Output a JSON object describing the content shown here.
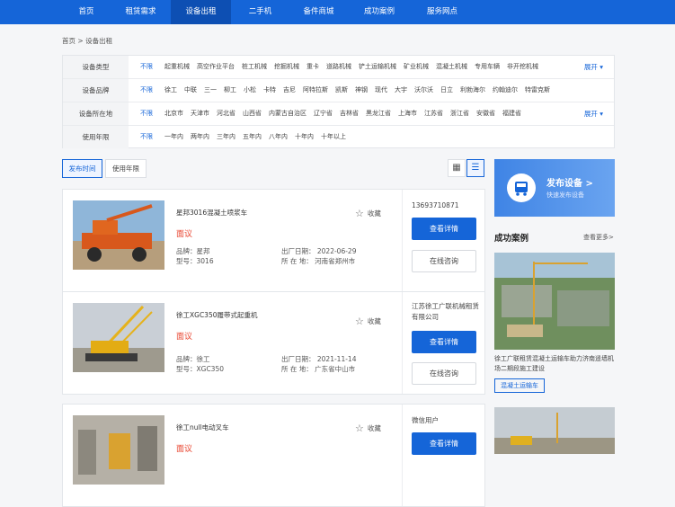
{
  "nav": {
    "items": [
      "首页",
      "租赁需求",
      "设备出租",
      "二手机",
      "备件商城",
      "成功案例",
      "服务网点"
    ],
    "active_index": 2
  },
  "breadcrumb": {
    "home": "首页",
    "separator": ">",
    "current": "设备出租"
  },
  "filters": [
    {
      "label": "设备类型",
      "selected": "不限",
      "options": [
        "起重机械",
        "高空作业平台",
        "桩工机械",
        "挖掘机械",
        "重卡",
        "道路机械",
        "铲土运输机械",
        "矿业机械",
        "混凝土机械",
        "专用车辆",
        "非开挖机械"
      ],
      "expand": "展开"
    },
    {
      "label": "设备品牌",
      "selected": "不限",
      "options": [
        "徐工",
        "中联",
        "三一",
        "柳工",
        "小松",
        "卡特",
        "吉尼",
        "阿特拉斯",
        "凯斯",
        "神钢",
        "现代",
        "大宇",
        "沃尔沃",
        "日立",
        "利勃海尔",
        "约翰迪尔",
        "特雷克斯"
      ],
      "expand": ""
    },
    {
      "label": "设备所在地",
      "selected": "不限",
      "options": [
        "北京市",
        "天津市",
        "河北省",
        "山西省",
        "内蒙古自治区",
        "辽宁省",
        "吉林省",
        "黑龙江省",
        "上海市",
        "江苏省",
        "浙江省",
        "安徽省",
        "福建省"
      ],
      "expand": "展开"
    },
    {
      "label": "使用年限",
      "selected": "不限",
      "options": [
        "一年内",
        "两年内",
        "三年内",
        "五年内",
        "八年内",
        "十年内",
        "十年以上"
      ],
      "expand": ""
    }
  ],
  "sort_tabs": [
    "发布时间",
    "使用年限"
  ],
  "listings": [
    {
      "title": "星邦3016混凝土喷浆车",
      "price": "面议",
      "brand_label": "品牌：",
      "brand": "星邦",
      "model_label": "型号：",
      "model": "3016",
      "date_label": "出厂日期：",
      "date": "2022-06-29",
      "loc_label": "所 在 地：",
      "location": "河南省郑州市",
      "fav": "收藏",
      "contact": "13693710871",
      "detail_btn": "查看详情",
      "consult_btn": "在线咨询"
    },
    {
      "title": "徐工XGC350履带式起重机",
      "price": "面议",
      "brand_label": "品牌：",
      "brand": "徐工",
      "model_label": "型号：",
      "model": "XGC350",
      "date_label": "出厂日期：",
      "date": "2021-11-14",
      "loc_label": "所 在 地：",
      "location": "广东省中山市",
      "fav": "收藏",
      "contact": "江苏徐工广联机械租赁有限公司",
      "detail_btn": "查看详情",
      "consult_btn": "在线咨询"
    },
    {
      "title": "徐工null电动叉车",
      "price": "面议",
      "fav": "收藏",
      "contact": "微信用户",
      "detail_btn": "查看详情"
    }
  ],
  "sidebar": {
    "publish_title": "发布设备 >",
    "publish_sub": "快速发布设备",
    "cases_title": "成功案例",
    "cases_more": "查看更多>",
    "case_caption": "徐工广联租赁混凝土运输车助力济南遥墙机场二期段施工建设",
    "case_tag": "混凝土运输车"
  },
  "colors": {
    "brand": "#1565d8",
    "price": "#e8442f",
    "nav_bg": "#1565d8"
  }
}
